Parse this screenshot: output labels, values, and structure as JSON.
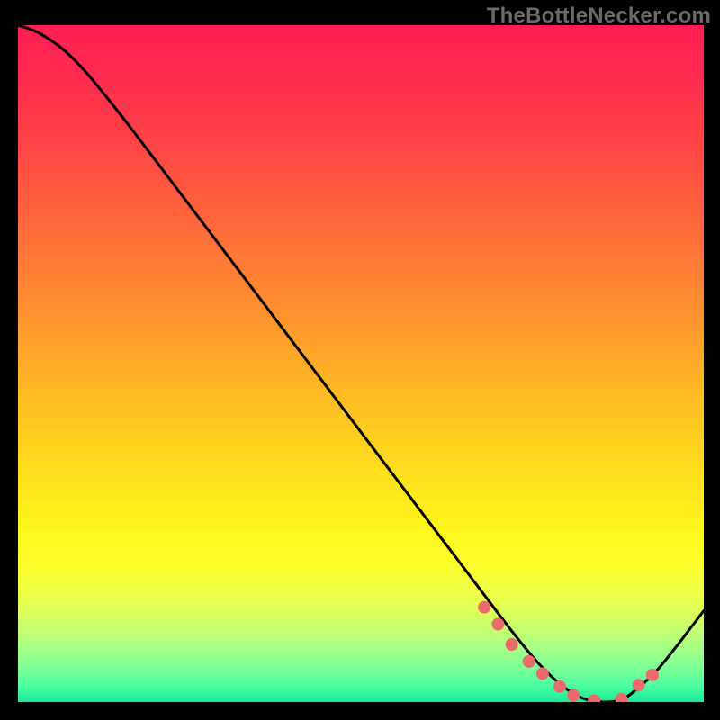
{
  "watermark": "TheBottleNecker.com",
  "chart_data": {
    "type": "line",
    "title": "",
    "xlabel": "",
    "ylabel": "",
    "xlim": [
      0,
      100
    ],
    "ylim": [
      0,
      100
    ],
    "background": {
      "kind": "vertical-gradient",
      "stops": [
        {
          "offset": 0.0,
          "color": "#ff1f52"
        },
        {
          "offset": 0.07,
          "color": "#ff2a4f"
        },
        {
          "offset": 0.15,
          "color": "#ff3e48"
        },
        {
          "offset": 0.25,
          "color": "#ff5b3f"
        },
        {
          "offset": 0.35,
          "color": "#ff7a36"
        },
        {
          "offset": 0.45,
          "color": "#ff9a2d"
        },
        {
          "offset": 0.55,
          "color": "#ffbc24"
        },
        {
          "offset": 0.65,
          "color": "#ffdb1e"
        },
        {
          "offset": 0.74,
          "color": "#fff51c"
        },
        {
          "offset": 0.8,
          "color": "#fcff2e"
        },
        {
          "offset": 0.85,
          "color": "#e9ff4e"
        },
        {
          "offset": 0.89,
          "color": "#c9ff6d"
        },
        {
          "offset": 0.92,
          "color": "#a6ff85"
        },
        {
          "offset": 0.95,
          "color": "#7dff96"
        },
        {
          "offset": 0.975,
          "color": "#4effa0"
        },
        {
          "offset": 1.0,
          "color": "#19e999"
        }
      ]
    },
    "series": [
      {
        "name": "curve",
        "x": [
          0.0,
          3.5,
          8.0,
          14.0,
          25.0,
          40.0,
          55.0,
          66.0,
          72.0,
          76.0,
          79.5,
          82.5,
          85.5,
          88.0,
          90.0,
          93.0,
          96.0,
          100.0
        ],
        "values": [
          100,
          98.6,
          95.1,
          88.0,
          73.4,
          53.3,
          33.2,
          18.5,
          10.5,
          5.6,
          2.3,
          0.5,
          0.0,
          0.4,
          1.7,
          4.5,
          8.2,
          13.5
        ]
      }
    ],
    "markers": {
      "name": "low-region-dots",
      "color": "#e96b6b",
      "x": [
        68.0,
        70.0,
        72.0,
        74.5,
        76.5,
        79.0,
        81.0,
        84.0,
        88.0,
        90.5,
        92.5
      ],
      "values": [
        14.0,
        11.5,
        8.5,
        6.0,
        4.2,
        2.3,
        1.0,
        0.2,
        0.4,
        2.5,
        4.0
      ]
    },
    "colors": {
      "curve": "#000000",
      "marker": "#e96b6b",
      "frame": "#000000"
    }
  }
}
